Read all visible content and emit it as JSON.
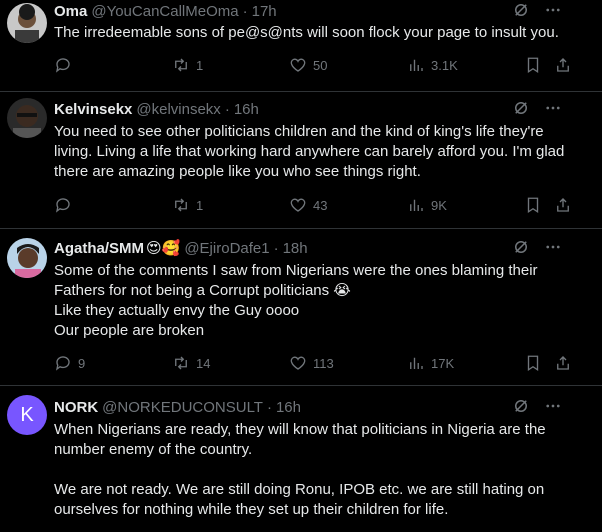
{
  "tweets": [
    {
      "name": "Oma",
      "handle": "@YouCanCallMeOma",
      "time": "17h",
      "text": [
        "The irredeemable sons of pe@s@nts will soon flock your page to insult you."
      ],
      "replies": "",
      "retweets": "1",
      "likes": "50",
      "views": "3.1K"
    },
    {
      "name": "Kelvinsekx",
      "handle": "@kelvinsekx",
      "time": "16h",
      "text": [
        "You need to see other politicians children and the kind of king's life they're living. Living a life that working hard anywhere can barely afford you. I'm glad there are amazing people like you who see things right."
      ],
      "replies": "",
      "retweets": "1",
      "likes": "43",
      "views": "9K"
    },
    {
      "name": "Agatha/SMM",
      "name_emoji": "😍🥰",
      "handle": "@EjiroDafe1",
      "time": "18h",
      "text": [
        "Some of the comments I saw from Nigerians were the ones blaming their Fathers for not being a Corrupt politicians 😭",
        "Like they actually envy the Guy oooo",
        "Our people are broken"
      ],
      "replies": "9",
      "retweets": "14",
      "likes": "113",
      "views": "17K"
    },
    {
      "name": "NORK",
      "handle": "@NORKEDUCONSULT",
      "time": "16h",
      "avatar_letter": "K",
      "text": [
        "When Nigerians are ready, they will know that politicians in Nigeria are the number enemy of the country.",
        "",
        "We are not ready. We are still doing Ronu, IPOB etc. we are still hating on ourselves for nothing while they set up their children for life."
      ]
    }
  ],
  "separator": "·",
  "colors": {
    "background": "#000000",
    "text": "#e7e9ea",
    "muted": "#71767b",
    "divider": "#2f3336",
    "nork_avatar": "#7856ff"
  },
  "icons": [
    "grok-icon",
    "more-icon",
    "reply-icon",
    "retweet-icon",
    "like-icon",
    "views-icon",
    "bookmark-icon",
    "share-icon"
  ]
}
